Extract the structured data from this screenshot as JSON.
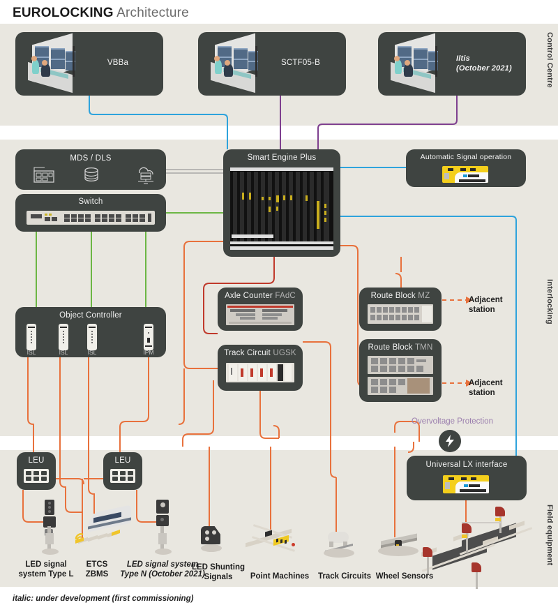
{
  "title": {
    "strong": "EUROLOCKING",
    "light": "Architecture"
  },
  "footnote": "italic: under development (first commissioning)",
  "bands": [
    {
      "name": "control-centre",
      "label": "Control Centre"
    },
    {
      "name": "interlocking",
      "label": "Interlocking"
    },
    {
      "name": "field-equipment",
      "label": "Field equipment"
    }
  ],
  "control_centre": {
    "nodes": [
      {
        "label": "VBBa",
        "italic": false
      },
      {
        "label": "SCTF05-B",
        "italic": false
      },
      {
        "label": "Iltis",
        "label2": "(October 2021)",
        "italic": true
      }
    ]
  },
  "interlocking": {
    "mds_dls": {
      "label": "MDS / DLS",
      "icons": [
        "patch-panel-icon",
        "database-icon",
        "cloud-server-icon"
      ]
    },
    "switch": {
      "label": "Switch",
      "icon": "network-switch-icon"
    },
    "smart_engine": {
      "label": "Smart Engine Plus",
      "icon": "card-rack-icon"
    },
    "automatic_signal": {
      "label": "Automatic Signal operation",
      "icon": "lx-controller-icon"
    },
    "object_controller": {
      "label": "Object Controller",
      "modules": [
        "ISL",
        "ISL",
        "ISL",
        "IPM"
      ]
    },
    "axle_counter": {
      "label": "Axle Counter",
      "sub": "FAdC"
    },
    "track_circuit": {
      "label": "Track Circuit",
      "sub": "UGSK"
    },
    "route_block_mz": {
      "label": "Route Block",
      "sub": "MZ"
    },
    "route_block_tmn": {
      "label": "Route Block",
      "sub": "TMN"
    },
    "adjacent_station_1": "Adjacent\nstation",
    "adjacent_station_1_l1": "Adjacent",
    "adjacent_station_1_l2": "station",
    "adjacent_station_2_l1": "Adjacent",
    "adjacent_station_2_l2": "station"
  },
  "field": {
    "overvoltage": {
      "label": "Overvoltage Protection",
      "icon": "lightning-bolt-icon"
    },
    "leu_left": {
      "label": "LEU",
      "icon": "connector-grid-icon"
    },
    "leu_right": {
      "label": "LEU",
      "icon": "connector-grid-icon"
    },
    "universal_lx": {
      "label": "Universal LX interface",
      "icon": "lx-controller-icon"
    },
    "items": [
      {
        "name": "led-signal-type-l",
        "l1": "LED signal",
        "l2": "system Type L",
        "italic": false
      },
      {
        "name": "etcs-zbms",
        "l1": "ETCS",
        "l2": "ZBMS",
        "italic": false
      },
      {
        "name": "led-signal-type-n",
        "l1": "LED signal system",
        "l2": "Type N (October 2021)",
        "italic": true
      },
      {
        "name": "led-shunting-signals",
        "l1": "LED Shunting",
        "l2": "Signals",
        "italic": false
      },
      {
        "name": "point-machines",
        "l1": "Point Machines",
        "l2": "",
        "italic": false
      },
      {
        "name": "track-circuits",
        "l1": "Track Circuits",
        "l2": "",
        "italic": false
      },
      {
        "name": "wheel-sensors",
        "l1": "Wheel Sensors",
        "l2": "",
        "italic": false
      }
    ]
  },
  "colors": {
    "band_bg": "#e9e7e0",
    "node_bg": "#3f4441",
    "wire_blue": "#2ea3dc",
    "wire_purple": "#7e3f8f",
    "wire_green": "#6cb644",
    "wire_orange": "#e8713c",
    "wire_red": "#c0392b",
    "wire_grey": "#9a9a9a",
    "overvoltage_text": "#9b7fae",
    "device_yellow": "#f4cf1c"
  }
}
